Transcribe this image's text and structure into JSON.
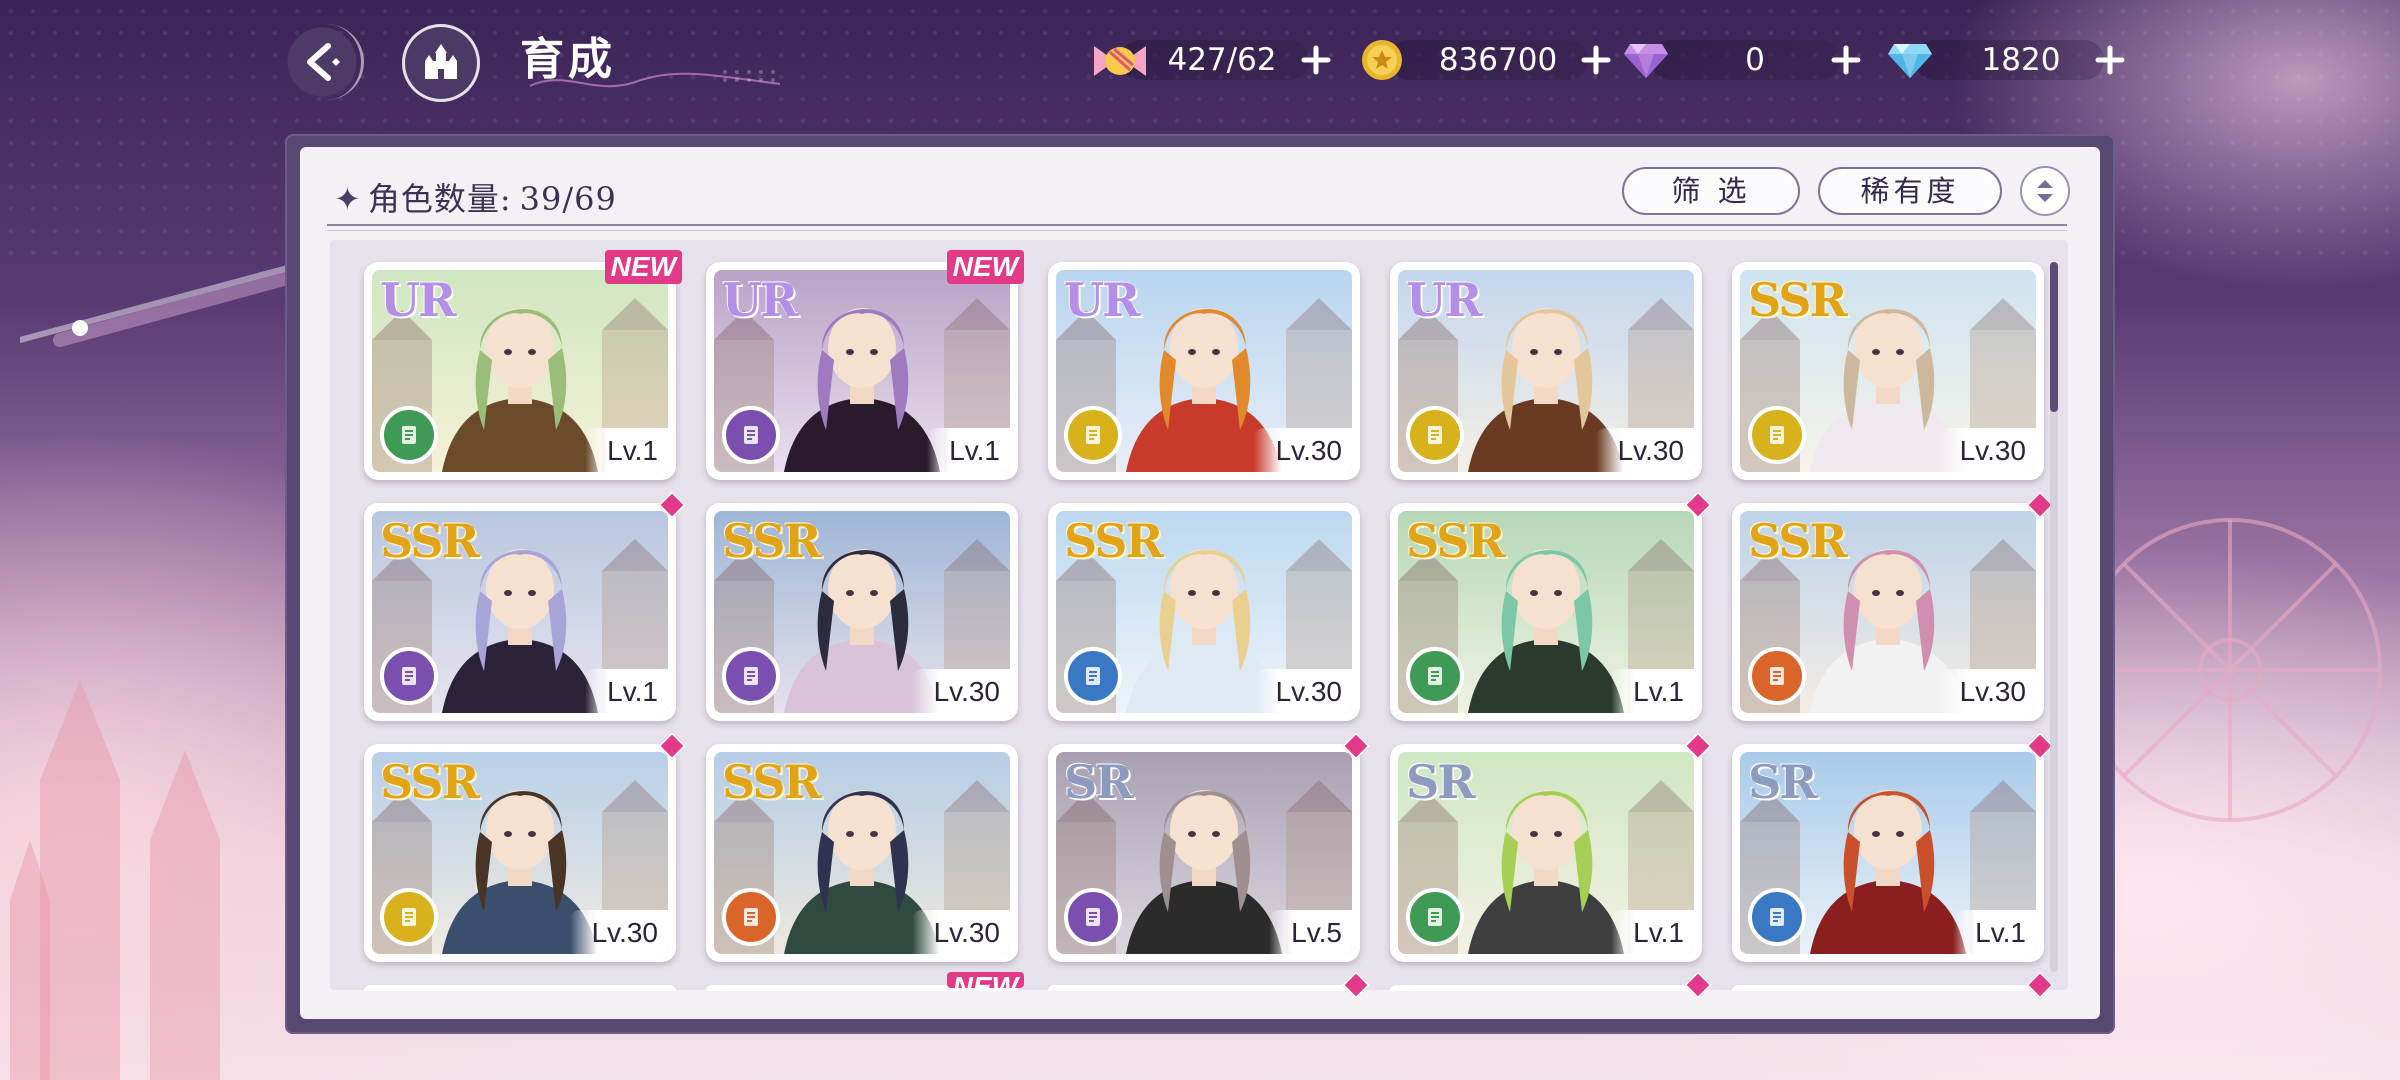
{
  "header": {
    "title": "育成"
  },
  "resources": [
    {
      "name": "candy",
      "value": "427/62",
      "add": "+"
    },
    {
      "name": "gold-coin",
      "value": "836700",
      "add": "+"
    },
    {
      "name": "purple-diamond",
      "value": "0",
      "add": "+"
    },
    {
      "name": "blue-diamond",
      "value": "1820",
      "add": "+"
    }
  ],
  "panel": {
    "count_label": "角色数量:",
    "count_value": "39/69",
    "filter_label": "筛 选",
    "sort_label": "稀有度"
  },
  "cards": [
    {
      "rarity": "UR",
      "level": "Lv.1",
      "badge": "NEW",
      "element": "green"
    },
    {
      "rarity": "UR",
      "level": "Lv.1",
      "badge": "NEW",
      "element": "purple"
    },
    {
      "rarity": "UR",
      "level": "Lv.30",
      "badge": "",
      "element": "yellow"
    },
    {
      "rarity": "UR",
      "level": "Lv.30",
      "badge": "",
      "element": "yellow"
    },
    {
      "rarity": "SSR",
      "level": "Lv.30",
      "badge": "",
      "element": "yellow"
    },
    {
      "rarity": "SSR",
      "level": "Lv.1",
      "badge": "dot",
      "element": "purple"
    },
    {
      "rarity": "SSR",
      "level": "Lv.30",
      "badge": "",
      "element": "purple"
    },
    {
      "rarity": "SSR",
      "level": "Lv.30",
      "badge": "",
      "element": "blue"
    },
    {
      "rarity": "SSR",
      "level": "Lv.1",
      "badge": "dot",
      "element": "green"
    },
    {
      "rarity": "SSR",
      "level": "Lv.30",
      "badge": "dot",
      "element": "orange"
    },
    {
      "rarity": "SSR",
      "level": "Lv.30",
      "badge": "dot",
      "element": "yellow"
    },
    {
      "rarity": "SSR",
      "level": "Lv.30",
      "badge": "",
      "element": "orange"
    },
    {
      "rarity": "SR",
      "level": "Lv.5",
      "badge": "dot",
      "element": "purple"
    },
    {
      "rarity": "SR",
      "level": "Lv.1",
      "badge": "dot",
      "element": "green"
    },
    {
      "rarity": "SR",
      "level": "Lv.1",
      "badge": "dot",
      "element": "blue"
    }
  ],
  "next_row_badges": [
    "",
    "NEW",
    "dot",
    "dot",
    "dot"
  ],
  "colors": {
    "green": "#3f9a55",
    "purple": "#7a4fb0",
    "yellow": "#d8b21c",
    "blue": "#3a78c4",
    "orange": "#d9652a"
  }
}
